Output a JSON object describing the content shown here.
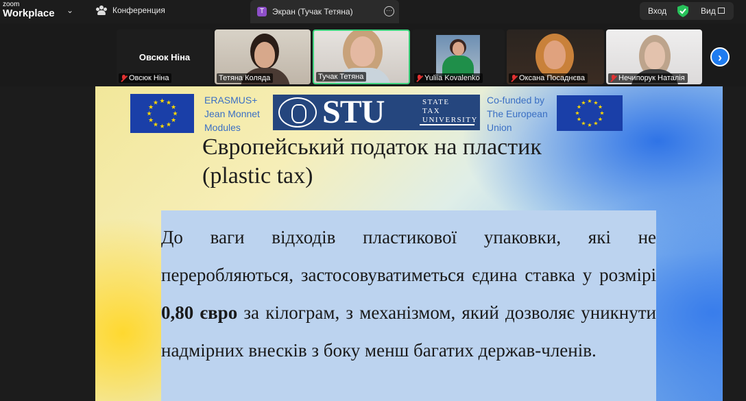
{
  "app": {
    "logo_top": "zoom",
    "logo_bottom": "Workplace"
  },
  "toolbar": {
    "conference_label": "Конференция",
    "share_tab_badge": "T",
    "share_tab_label": "Экран (Тучак Тетяна)",
    "login_label": "Вход",
    "view_label": "Вид"
  },
  "participants": [
    {
      "name": "Овсюк Ніна",
      "muted": true,
      "video": false
    },
    {
      "name": "Тетяна Коляда",
      "muted": false,
      "video": true
    },
    {
      "name": "Тучак Тетяна",
      "muted": false,
      "video": true,
      "active_speaker": true
    },
    {
      "name": "Yuliia Kovalenko",
      "muted": true,
      "video": true
    },
    {
      "name": "Оксана Посаднєва",
      "muted": true,
      "video": true
    },
    {
      "name": "Нечипорук Наталія",
      "muted": true,
      "video": true
    }
  ],
  "slide": {
    "erasmus_lines": [
      "ERASMUS+",
      "Jean Monnet",
      "Modules"
    ],
    "stu_logo": "STU",
    "stu_lines": [
      "STATE",
      "TAX",
      "UNIVERSITY"
    ],
    "cofunded_lines": [
      "Co-funded by",
      "The European",
      "Union"
    ],
    "title_line1": "Європейський податок на пластик",
    "title_line2": "(plastic tax)",
    "body_before": "До ваги відходів пластикової упаковки, які не переробляються, застосовуватиметься єдина ставка у розмірі ",
    "body_bold": "0,80 євро",
    "body_after": " за кілограм, з механізмом, який дозволяє уникнути надмірних внесків з боку менш багатих держав-членів."
  },
  "colors": {
    "accent": "#1f7cf0",
    "active_border": "#3cd27c",
    "muted_mic": "#e03131",
    "shield": "#27c25a"
  }
}
